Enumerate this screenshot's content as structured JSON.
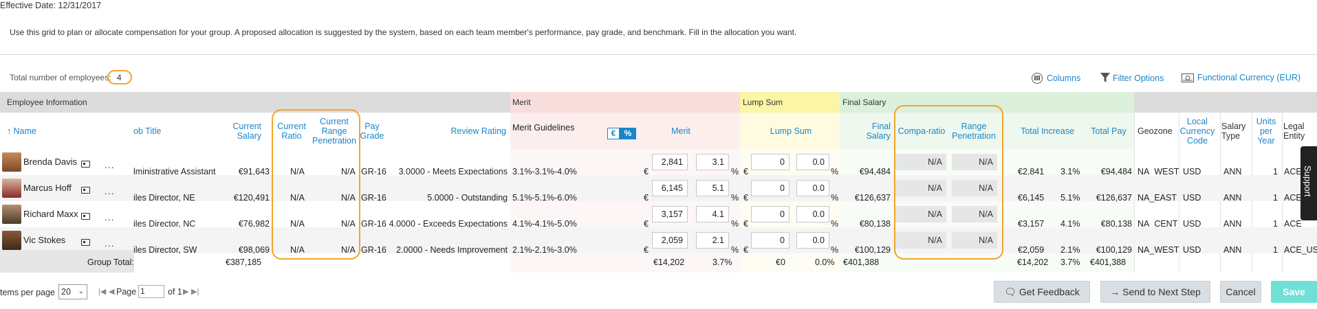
{
  "header": {
    "effective_date": "Effective Date: 12/31/2017",
    "instructions": "Use this grid to plan or allocate compensation for your group. A proposed allocation is suggested by the system, based on each team member's performance, pay grade, and benchmark. Fill in the allocation you want.",
    "total_label": "Total number of employees:",
    "total_value": "4"
  },
  "toolbar": {
    "columns": "Columns",
    "filter": "Filter Options",
    "currency": "Functional Currency (EUR)"
  },
  "groups": {
    "employee_info": "Employee Information",
    "merit": "Merit",
    "lump_sum": "Lump Sum",
    "final_salary": "Final Salary"
  },
  "columns": {
    "name": "Name",
    "job_title": "ob Title",
    "current_salary": "Current Salary",
    "current_ratio": "Current Ratio",
    "current_range_penetration": "Current Range Penetration",
    "pay_grade": "Pay Grade",
    "review_rating": "Review Rating",
    "merit_guidelines": "Merit Guidelines",
    "toggle_euro": "€",
    "toggle_pct": "%",
    "merit": "Merit",
    "lump_sum": "Lump Sum",
    "final_salary": "Final Salary",
    "compa_ratio": "Compa-ratio",
    "range_penetration": "Range Penetration",
    "total_increase": "Total Increase",
    "total_pay": "Total Pay",
    "geozone": "Geozone",
    "local_currency_code": "Local Currency Code",
    "salary_type": "Salary Type",
    "units_per_year": "Units per Year",
    "legal_entity": "Legal Entity"
  },
  "employees": [
    {
      "name": "Brenda Davis",
      "more": "...",
      "job": "lministrative Assistant",
      "salary": "€91,643",
      "ratio": "N/A",
      "crp": "N/A",
      "grade": "GR-16",
      "rating": "3.0000 - Meets Expectations",
      "guidelines": "3.1%-3.1%-4.0%",
      "merit_cur": "€",
      "merit_amt": "2,841",
      "merit_pct": "3.1",
      "pct": "%",
      "lump_cur": "€",
      "lump_amt": "0",
      "lump_pct": "0.0",
      "final": "€94,484",
      "compa": "N/A",
      "rp": "N/A",
      "inc_amt": "€2,841",
      "inc_pct": "3.1%",
      "total_pay": "€94,484",
      "geozone": "NA_WEST",
      "ccy": "USD",
      "stype": "ANN",
      "units": "1",
      "entity": "ACE_"
    },
    {
      "name": "Marcus Hoff",
      "more": "...",
      "job": "iles Director, NE",
      "salary": "€120,491",
      "ratio": "N/A",
      "crp": "N/A",
      "grade": "GR-16",
      "rating": "5.0000 - Outstanding",
      "guidelines": "5.1%-5.1%-6.0%",
      "merit_cur": "€",
      "merit_amt": "6,145",
      "merit_pct": "5.1",
      "pct": "%",
      "lump_cur": "€",
      "lump_amt": "0",
      "lump_pct": "0.0",
      "final": "€126,637",
      "compa": "N/A",
      "rp": "N/A",
      "inc_amt": "€6,145",
      "inc_pct": "5.1%",
      "total_pay": "€126,637",
      "geozone": "NA_EAST",
      "ccy": "USD",
      "stype": "ANN",
      "units": "1",
      "entity": "ACE_"
    },
    {
      "name": "Richard Maxx",
      "more": "...",
      "job": "iles Director, NC",
      "salary": "€76,982",
      "ratio": "N/A",
      "crp": "N/A",
      "grade": "GR-16",
      "rating": "4.0000 - Exceeds Expectations",
      "guidelines": "4.1%-4.1%-5.0%",
      "merit_cur": "€",
      "merit_amt": "3,157",
      "merit_pct": "4.1",
      "pct": "%",
      "lump_cur": "€",
      "lump_amt": "0",
      "lump_pct": "0.0",
      "final": "€80,138",
      "compa": "N/A",
      "rp": "N/A",
      "inc_amt": "€3,157",
      "inc_pct": "4.1%",
      "total_pay": "€80,138",
      "geozone": "NA_CENT",
      "ccy": "USD",
      "stype": "ANN",
      "units": "1",
      "entity": "ACE_"
    },
    {
      "name": "Vic Stokes",
      "more": "...",
      "job": "iles Director, SW",
      "salary": "€98,069",
      "ratio": "N/A",
      "crp": "N/A",
      "grade": "GR-16",
      "rating": "2.0000 - Needs Improvement",
      "guidelines": "2.1%-2.1%-3.0%",
      "merit_cur": "€",
      "merit_amt": "2,059",
      "merit_pct": "2.1",
      "pct": "%",
      "lump_cur": "€",
      "lump_amt": "0",
      "lump_pct": "0.0",
      "final": "€100,129",
      "compa": "N/A",
      "rp": "N/A",
      "inc_amt": "€2,059",
      "inc_pct": "2.1%",
      "total_pay": "€100,129",
      "geozone": "NA_WEST",
      "ccy": "USD",
      "stype": "ANN",
      "units": "1",
      "entity": "ACE_USA"
    }
  ],
  "group_total": {
    "label": "Group Total:",
    "salary": "€387,185",
    "merit": "€14,202",
    "merit_pct": "3.7%",
    "lump": "€0",
    "lump_pct": "0.0%",
    "final": "€401,388",
    "inc": "€14,202",
    "inc_pct": "3.7%",
    "total_pay": "€401,388"
  },
  "pager": {
    "items_label": "tems per page",
    "items_value": "20",
    "page_label": "Page",
    "page_value": "1",
    "of_label": "of 1"
  },
  "buttons": {
    "feedback": "Get Feedback",
    "next_step": "Send to Next Step",
    "cancel": "Cancel",
    "save": "Save"
  },
  "support": "Support"
}
